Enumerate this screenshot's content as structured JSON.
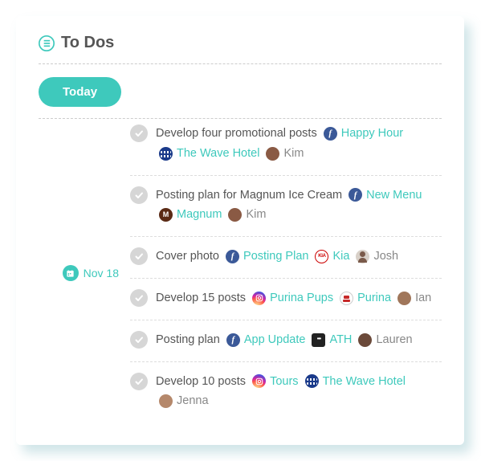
{
  "header": {
    "title": "To Dos"
  },
  "today_label": "Today",
  "date": "Nov 18",
  "tasks": [
    {
      "title": "Develop four promotional posts",
      "tags": [
        {
          "icon": "facebook",
          "label": "Happy Hour",
          "kind": "link"
        },
        {
          "icon": "wave",
          "label": "The Wave Hotel",
          "kind": "link"
        },
        {
          "icon": "avatar",
          "label": "Kim",
          "kind": "person"
        }
      ]
    },
    {
      "title": "Posting plan for Magnum Ice Cream",
      "tags": [
        {
          "icon": "facebook",
          "label": "New Menu",
          "kind": "link"
        },
        {
          "icon": "magnum",
          "label": "Magnum",
          "kind": "link"
        },
        {
          "icon": "avatar",
          "label": "Kim",
          "kind": "person"
        }
      ]
    },
    {
      "title": "Cover photo",
      "tags": [
        {
          "icon": "facebook",
          "label": "Posting Plan",
          "kind": "link"
        },
        {
          "icon": "kia",
          "label": "Kia",
          "kind": "link"
        },
        {
          "icon": "josh",
          "label": "Josh",
          "kind": "person"
        }
      ]
    },
    {
      "title": "Develop 15 posts",
      "tags": [
        {
          "icon": "instagram",
          "label": "Purina Pups",
          "kind": "link"
        },
        {
          "icon": "purina",
          "label": "Purina",
          "kind": "link"
        },
        {
          "icon": "avatar2",
          "label": "Ian",
          "kind": "person"
        }
      ]
    },
    {
      "title": "Posting plan",
      "tags": [
        {
          "icon": "facebook",
          "label": "App Update",
          "kind": "link"
        },
        {
          "icon": "ath",
          "label": "ATH",
          "kind": "link"
        },
        {
          "icon": "avatar3",
          "label": "Lauren",
          "kind": "person"
        }
      ]
    },
    {
      "title": "Develop 10 posts",
      "tags": [
        {
          "icon": "instagram",
          "label": "Tours",
          "kind": "link"
        },
        {
          "icon": "wave",
          "label": "The Wave Hotel",
          "kind": "link"
        },
        {
          "icon": "avatar4",
          "label": "Jenna",
          "kind": "person"
        }
      ]
    }
  ]
}
